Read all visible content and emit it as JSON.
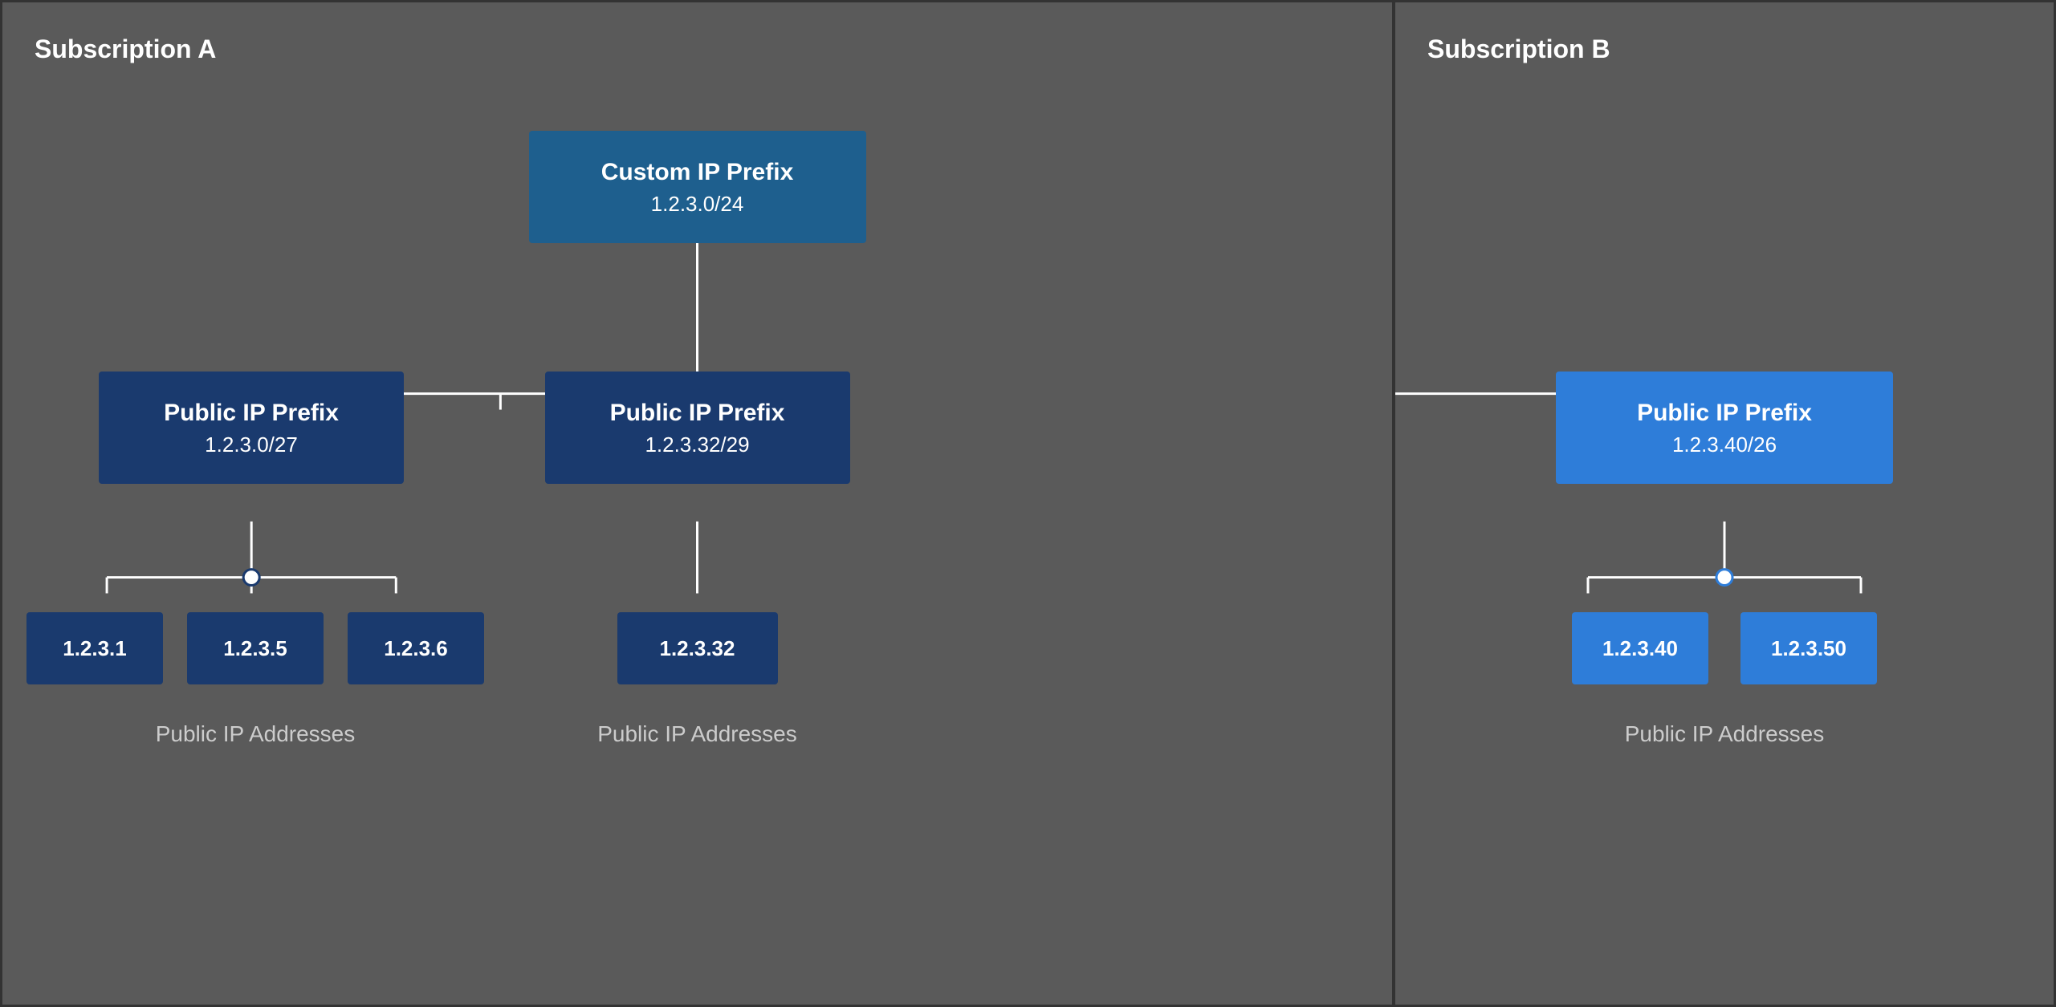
{
  "subscriptionA": {
    "label": "Subscription A"
  },
  "subscriptionB": {
    "label": "Subscription B"
  },
  "customIPPrefix": {
    "title": "Custom IP Prefix",
    "subtitle": "1.2.3.0/24"
  },
  "prefixLeft": {
    "title": "Public IP Prefix",
    "subtitle": "1.2.3.0/27"
  },
  "prefixCenter": {
    "title": "Public IP Prefix",
    "subtitle": "1.2.3.32/29"
  },
  "prefixB": {
    "title": "Public IP Prefix",
    "subtitle": "1.2.3.40/26"
  },
  "leafLeft1": "1.2.3.1",
  "leafLeft2": "1.2.3.5",
  "leafLeft3": "1.2.3.6",
  "leafCenter": "1.2.3.32",
  "leafB1": "1.2.3.40",
  "leafB2": "1.2.3.50",
  "publicIPLabel": "Public IP Addresses"
}
